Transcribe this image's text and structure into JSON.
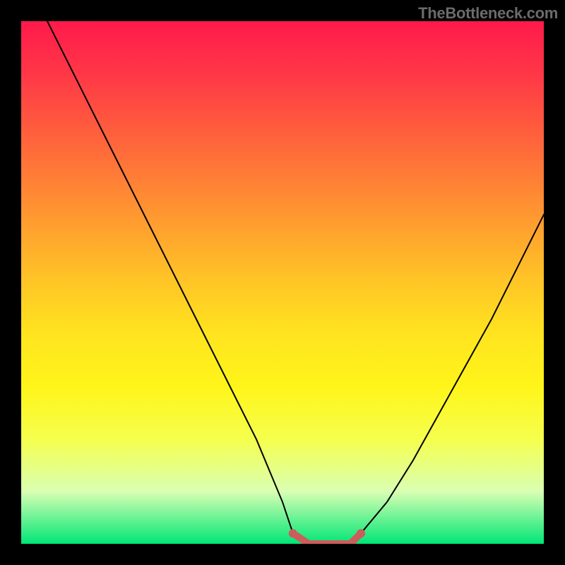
{
  "watermark": "TheBottleneck.com",
  "chart_data": {
    "type": "line",
    "title": "",
    "xlabel": "",
    "ylabel": "",
    "xlim": [
      0,
      100
    ],
    "ylim": [
      0,
      100
    ],
    "series": [
      {
        "name": "bottleneck-curve",
        "x": [
          5,
          10,
          15,
          20,
          25,
          30,
          35,
          40,
          45,
          50,
          52,
          55,
          58,
          60,
          63,
          65,
          70,
          75,
          80,
          85,
          90,
          95,
          100
        ],
        "values": [
          100,
          90,
          80,
          70,
          60,
          50,
          40,
          30,
          20,
          8,
          2,
          0,
          0,
          0,
          0,
          2,
          8,
          16,
          25,
          34,
          43,
          53,
          63
        ]
      },
      {
        "name": "flat-minimum-marker",
        "x": [
          52,
          55,
          58,
          60,
          63,
          65
        ],
        "values": [
          2,
          0,
          0,
          0,
          0,
          2
        ]
      }
    ],
    "annotations": []
  },
  "colors": {
    "curve": "#000000",
    "marker": "#cd5c5c",
    "background_top": "#ff1a4b",
    "background_bottom": "#00e676",
    "frame": "#000000"
  }
}
